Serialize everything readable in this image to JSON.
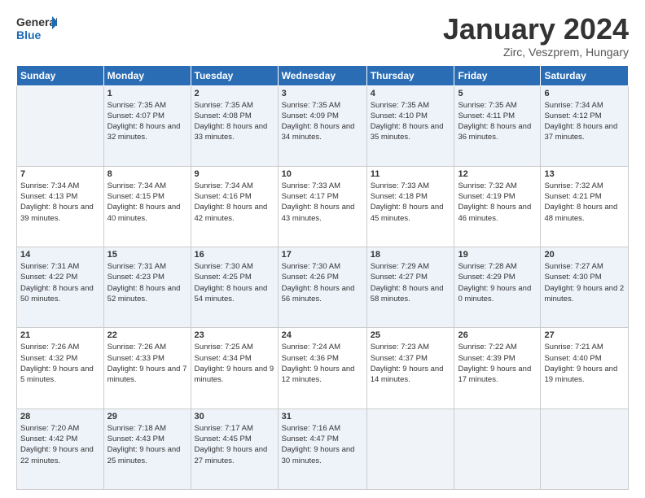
{
  "header": {
    "logo_general": "General",
    "logo_blue": "Blue",
    "month": "January 2024",
    "location": "Zirc, Veszprem, Hungary"
  },
  "weekdays": [
    "Sunday",
    "Monday",
    "Tuesday",
    "Wednesday",
    "Thursday",
    "Friday",
    "Saturday"
  ],
  "weeks": [
    [
      {
        "day": "",
        "sunrise": "",
        "sunset": "",
        "daylight": ""
      },
      {
        "day": "1",
        "sunrise": "7:35 AM",
        "sunset": "4:07 PM",
        "daylight": "8 hours and 32 minutes."
      },
      {
        "day": "2",
        "sunrise": "7:35 AM",
        "sunset": "4:08 PM",
        "daylight": "8 hours and 33 minutes."
      },
      {
        "day": "3",
        "sunrise": "7:35 AM",
        "sunset": "4:09 PM",
        "daylight": "8 hours and 34 minutes."
      },
      {
        "day": "4",
        "sunrise": "7:35 AM",
        "sunset": "4:10 PM",
        "daylight": "8 hours and 35 minutes."
      },
      {
        "day": "5",
        "sunrise": "7:35 AM",
        "sunset": "4:11 PM",
        "daylight": "8 hours and 36 minutes."
      },
      {
        "day": "6",
        "sunrise": "7:34 AM",
        "sunset": "4:12 PM",
        "daylight": "8 hours and 37 minutes."
      }
    ],
    [
      {
        "day": "7",
        "sunrise": "7:34 AM",
        "sunset": "4:13 PM",
        "daylight": "8 hours and 39 minutes."
      },
      {
        "day": "8",
        "sunrise": "7:34 AM",
        "sunset": "4:15 PM",
        "daylight": "8 hours and 40 minutes."
      },
      {
        "day": "9",
        "sunrise": "7:34 AM",
        "sunset": "4:16 PM",
        "daylight": "8 hours and 42 minutes."
      },
      {
        "day": "10",
        "sunrise": "7:33 AM",
        "sunset": "4:17 PM",
        "daylight": "8 hours and 43 minutes."
      },
      {
        "day": "11",
        "sunrise": "7:33 AM",
        "sunset": "4:18 PM",
        "daylight": "8 hours and 45 minutes."
      },
      {
        "day": "12",
        "sunrise": "7:32 AM",
        "sunset": "4:19 PM",
        "daylight": "8 hours and 46 minutes."
      },
      {
        "day": "13",
        "sunrise": "7:32 AM",
        "sunset": "4:21 PM",
        "daylight": "8 hours and 48 minutes."
      }
    ],
    [
      {
        "day": "14",
        "sunrise": "7:31 AM",
        "sunset": "4:22 PM",
        "daylight": "8 hours and 50 minutes."
      },
      {
        "day": "15",
        "sunrise": "7:31 AM",
        "sunset": "4:23 PM",
        "daylight": "8 hours and 52 minutes."
      },
      {
        "day": "16",
        "sunrise": "7:30 AM",
        "sunset": "4:25 PM",
        "daylight": "8 hours and 54 minutes."
      },
      {
        "day": "17",
        "sunrise": "7:30 AM",
        "sunset": "4:26 PM",
        "daylight": "8 hours and 56 minutes."
      },
      {
        "day": "18",
        "sunrise": "7:29 AM",
        "sunset": "4:27 PM",
        "daylight": "8 hours and 58 minutes."
      },
      {
        "day": "19",
        "sunrise": "7:28 AM",
        "sunset": "4:29 PM",
        "daylight": "9 hours and 0 minutes."
      },
      {
        "day": "20",
        "sunrise": "7:27 AM",
        "sunset": "4:30 PM",
        "daylight": "9 hours and 2 minutes."
      }
    ],
    [
      {
        "day": "21",
        "sunrise": "7:26 AM",
        "sunset": "4:32 PM",
        "daylight": "9 hours and 5 minutes."
      },
      {
        "day": "22",
        "sunrise": "7:26 AM",
        "sunset": "4:33 PM",
        "daylight": "9 hours and 7 minutes."
      },
      {
        "day": "23",
        "sunrise": "7:25 AM",
        "sunset": "4:34 PM",
        "daylight": "9 hours and 9 minutes."
      },
      {
        "day": "24",
        "sunrise": "7:24 AM",
        "sunset": "4:36 PM",
        "daylight": "9 hours and 12 minutes."
      },
      {
        "day": "25",
        "sunrise": "7:23 AM",
        "sunset": "4:37 PM",
        "daylight": "9 hours and 14 minutes."
      },
      {
        "day": "26",
        "sunrise": "7:22 AM",
        "sunset": "4:39 PM",
        "daylight": "9 hours and 17 minutes."
      },
      {
        "day": "27",
        "sunrise": "7:21 AM",
        "sunset": "4:40 PM",
        "daylight": "9 hours and 19 minutes."
      }
    ],
    [
      {
        "day": "28",
        "sunrise": "7:20 AM",
        "sunset": "4:42 PM",
        "daylight": "9 hours and 22 minutes."
      },
      {
        "day": "29",
        "sunrise": "7:18 AM",
        "sunset": "4:43 PM",
        "daylight": "9 hours and 25 minutes."
      },
      {
        "day": "30",
        "sunrise": "7:17 AM",
        "sunset": "4:45 PM",
        "daylight": "9 hours and 27 minutes."
      },
      {
        "day": "31",
        "sunrise": "7:16 AM",
        "sunset": "4:47 PM",
        "daylight": "9 hours and 30 minutes."
      },
      {
        "day": "",
        "sunrise": "",
        "sunset": "",
        "daylight": ""
      },
      {
        "day": "",
        "sunrise": "",
        "sunset": "",
        "daylight": ""
      },
      {
        "day": "",
        "sunrise": "",
        "sunset": "",
        "daylight": ""
      }
    ]
  ]
}
